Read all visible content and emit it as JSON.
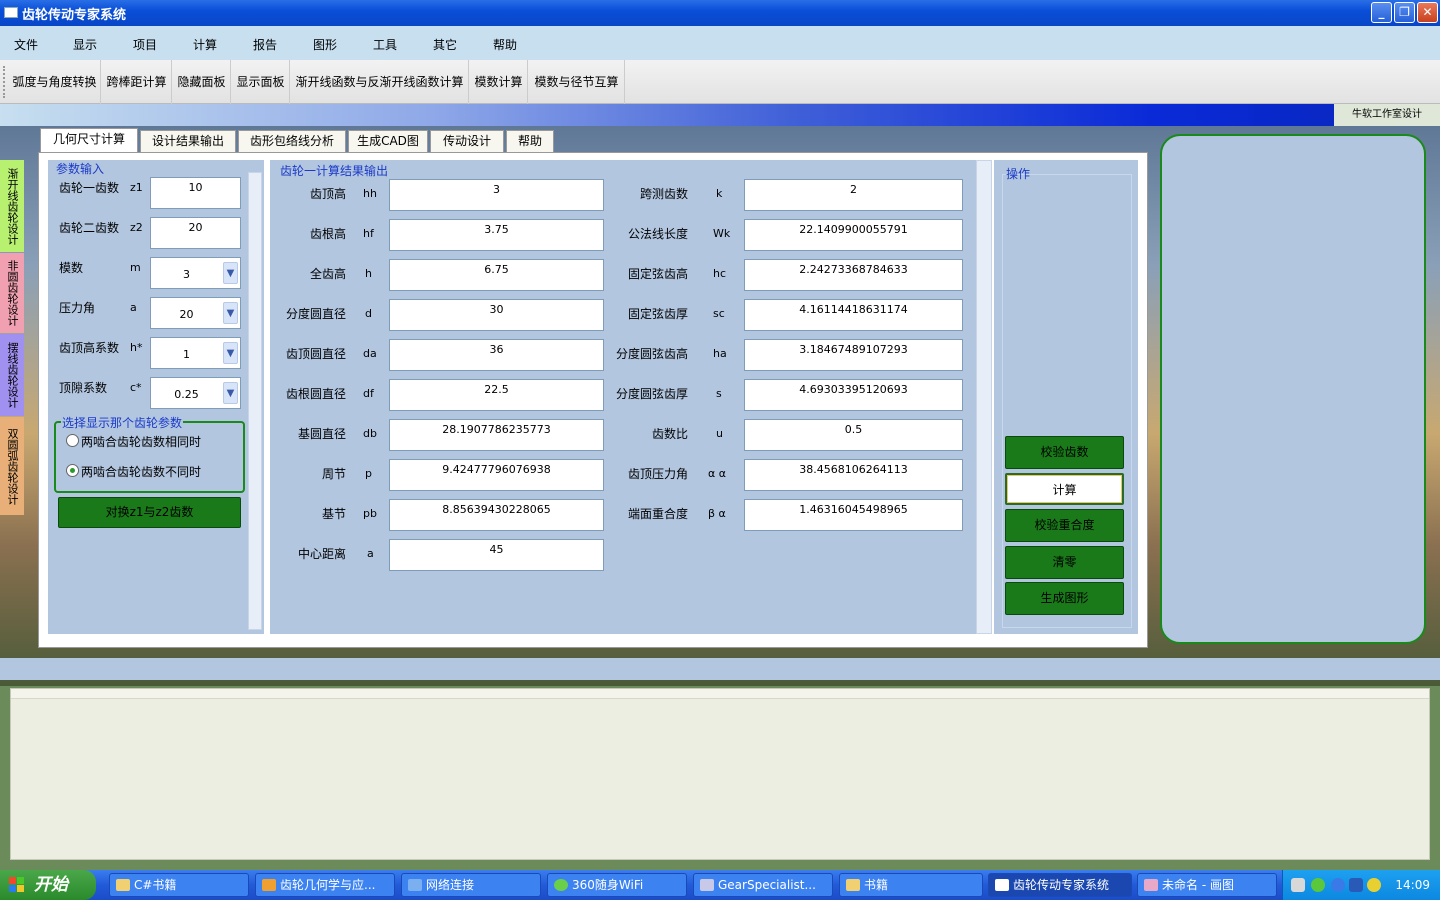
{
  "window": {
    "title": "齿轮传动专家系统"
  },
  "menu": [
    "文件",
    "显示",
    "项目",
    "计算",
    "报告",
    "图形",
    "工具",
    "其它",
    "帮助"
  ],
  "toolbar": [
    "弧度与角度转换",
    "跨棒距计算",
    "隐藏面板",
    "显示面板",
    "渐开线函数与反渐开线函数计算",
    "模数计算",
    "模数与径节互算"
  ],
  "studio_label": "牛软工作室设计",
  "side_tabs": [
    "渐开线齿轮设计",
    "非圆齿轮设计",
    "摆线齿轮设计",
    "双圆弧齿轮设计"
  ],
  "tabs": [
    "几何尺寸计算",
    "设计结果输出",
    "齿形包络线分析",
    "生成CAD图",
    "传动设计",
    "帮助"
  ],
  "input_group": {
    "title": "参数输入",
    "fields": [
      {
        "label": "齿轮一齿数",
        "sym": "z1",
        "value": "10"
      },
      {
        "label": "齿轮二齿数",
        "sym": "z2",
        "value": "20"
      }
    ],
    "combos": [
      {
        "label": "模数",
        "sym": "m",
        "value": "3"
      },
      {
        "label": "压力角",
        "sym": "a",
        "value": "20"
      },
      {
        "label": "齿顶高系数",
        "sym": "h*",
        "value": "1"
      },
      {
        "label": "顶隙系数",
        "sym": "c*",
        "value": "0.25"
      }
    ],
    "radio_title": "选择显示那个齿轮参数",
    "radios": [
      {
        "label": "两啮合齿轮齿数相同时",
        "checked": false
      },
      {
        "label": "两啮合齿轮齿数不同时",
        "checked": true
      }
    ],
    "swap_button": "对换z1与z2齿数"
  },
  "results": {
    "title": "齿轮一计算结果输出",
    "left": [
      {
        "label": "齿顶高",
        "sym": "hh",
        "value": "3"
      },
      {
        "label": "齿根高",
        "sym": "hf",
        "value": "3.75"
      },
      {
        "label": "全齿高",
        "sym": "h",
        "value": "6.75"
      },
      {
        "label": "分度圆直径",
        "sym": "d",
        "value": "30"
      },
      {
        "label": "齿顶圆直径",
        "sym": "da",
        "value": "36"
      },
      {
        "label": "齿根圆直径",
        "sym": "df",
        "value": "22.5"
      },
      {
        "label": "基圆直径",
        "sym": "db",
        "value": "28.1907786235773"
      },
      {
        "label": "周节",
        "sym": "p",
        "value": "9.42477796076938"
      },
      {
        "label": "基节",
        "sym": "pb",
        "value": "8.85639430228065"
      },
      {
        "label": "中心距离",
        "sym": "a",
        "value": "45"
      }
    ],
    "right": [
      {
        "label": "跨测齿数",
        "sym": "k",
        "value": "2"
      },
      {
        "label": "公法线长度",
        "sym": "Wk",
        "value": "22.1409900055791"
      },
      {
        "label": "固定弦齿高",
        "sym": "hc",
        "value": "2.24273368784633"
      },
      {
        "label": "固定弦齿厚",
        "sym": "sc",
        "value": "4.16114418631174"
      },
      {
        "label": "分度圆弦齿高",
        "sym": "ha",
        "value": "3.18467489107293"
      },
      {
        "label": "分度圆弦齿厚",
        "sym": "s",
        "value": "4.69303395120693"
      },
      {
        "label": "齿数比",
        "sym": "u",
        "value": "0.5"
      },
      {
        "label": "齿顶压力角",
        "sym": "α α",
        "value": "38.4568106264113"
      },
      {
        "label": "端面重合度",
        "sym": "β α",
        "value": "1.46316045498965"
      }
    ]
  },
  "ops": {
    "title": "操作",
    "buttons": [
      "校验齿数",
      "计算",
      "校验重合度",
      "清零",
      "生成图形"
    ]
  },
  "taskbar": {
    "start": "开始",
    "tasks": [
      "C#书籍",
      "齿轮几何学与应...",
      "网络连接",
      "360随身WiFi",
      "GearSpecialist...",
      "书籍",
      "齿轮传动专家系统",
      "未命名 - 画图"
    ],
    "clock": "14:09"
  }
}
